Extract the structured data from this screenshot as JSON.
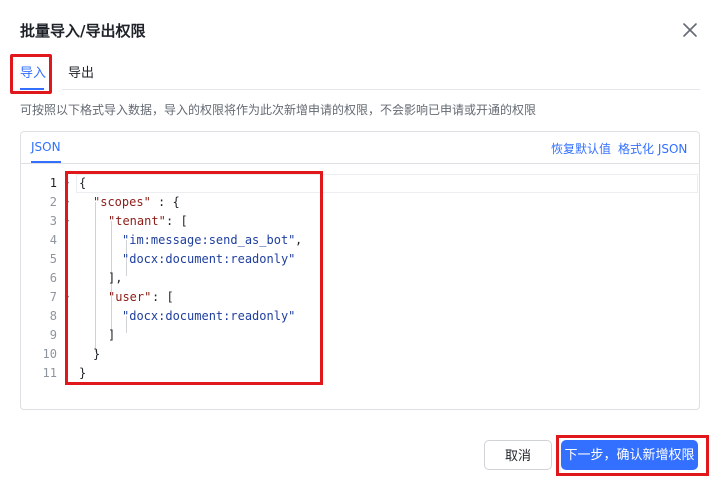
{
  "dialog": {
    "title": "批量导入/导出权限",
    "close_icon": "close-icon"
  },
  "tabs": [
    {
      "label": "导入",
      "active": true
    },
    {
      "label": "导出",
      "active": false
    }
  ],
  "description": "可按照以下格式导入数据，导入的权限将作为此次新增申请的权限，不会影响已申请或开通的权限",
  "editor": {
    "tab_label": "JSON",
    "actions": {
      "restore_default": "恢复默认值",
      "format_json": "格式化 JSON"
    },
    "line_numbers": [
      "1",
      "2",
      "3",
      "4",
      "5",
      "6",
      "7",
      "8",
      "9",
      "10",
      "11"
    ],
    "lines": [
      {
        "punct_open": "{"
      },
      {
        "key": "\"scopes\"",
        "rest": ": {"
      },
      {
        "key": "\"tenant\"",
        "rest": ": ["
      },
      {
        "str": "\"im:message:send_as_bot\"",
        "rest": ","
      },
      {
        "str": "\"docx:document:readonly\""
      },
      {
        "punct": "],"
      },
      {
        "key": "\"user\"",
        "rest": ": ["
      },
      {
        "str": "\"docx:document:readonly\""
      },
      {
        "punct": "]"
      },
      {
        "punct": "}"
      },
      {
        "punct": "}"
      }
    ]
  },
  "footer": {
    "cancel_label": "取消",
    "confirm_label": "下一步，确认新增权限"
  },
  "colors": {
    "accent": "#3370ff",
    "annotation_red": "#e0181b",
    "json_key": "#8c1d18",
    "json_string": "#1f3f9e"
  }
}
